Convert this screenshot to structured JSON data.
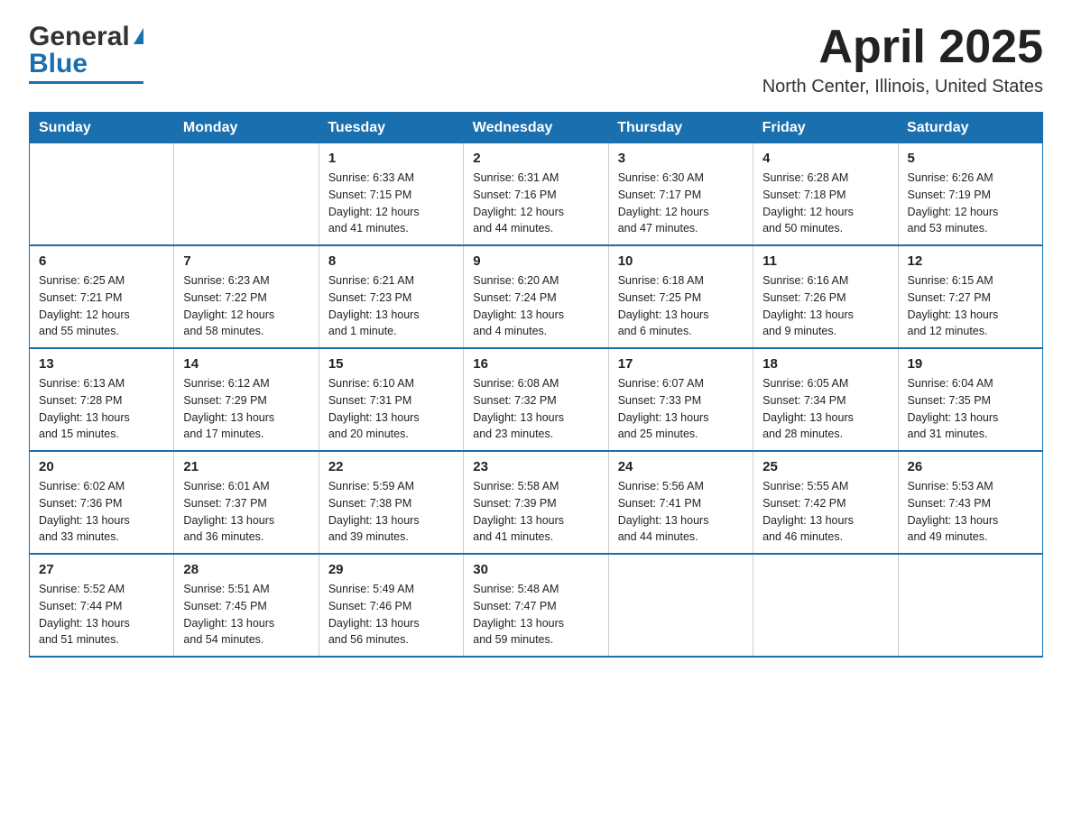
{
  "logo": {
    "text_general": "General",
    "text_blue": "Blue",
    "aria": "GeneralBlue logo"
  },
  "header": {
    "month_title": "April 2025",
    "location": "North Center, Illinois, United States"
  },
  "weekdays": [
    "Sunday",
    "Monday",
    "Tuesday",
    "Wednesday",
    "Thursday",
    "Friday",
    "Saturday"
  ],
  "weeks": [
    [
      {
        "day": "",
        "info": ""
      },
      {
        "day": "",
        "info": ""
      },
      {
        "day": "1",
        "info": "Sunrise: 6:33 AM\nSunset: 7:15 PM\nDaylight: 12 hours\nand 41 minutes."
      },
      {
        "day": "2",
        "info": "Sunrise: 6:31 AM\nSunset: 7:16 PM\nDaylight: 12 hours\nand 44 minutes."
      },
      {
        "day": "3",
        "info": "Sunrise: 6:30 AM\nSunset: 7:17 PM\nDaylight: 12 hours\nand 47 minutes."
      },
      {
        "day": "4",
        "info": "Sunrise: 6:28 AM\nSunset: 7:18 PM\nDaylight: 12 hours\nand 50 minutes."
      },
      {
        "day": "5",
        "info": "Sunrise: 6:26 AM\nSunset: 7:19 PM\nDaylight: 12 hours\nand 53 minutes."
      }
    ],
    [
      {
        "day": "6",
        "info": "Sunrise: 6:25 AM\nSunset: 7:21 PM\nDaylight: 12 hours\nand 55 minutes."
      },
      {
        "day": "7",
        "info": "Sunrise: 6:23 AM\nSunset: 7:22 PM\nDaylight: 12 hours\nand 58 minutes."
      },
      {
        "day": "8",
        "info": "Sunrise: 6:21 AM\nSunset: 7:23 PM\nDaylight: 13 hours\nand 1 minute."
      },
      {
        "day": "9",
        "info": "Sunrise: 6:20 AM\nSunset: 7:24 PM\nDaylight: 13 hours\nand 4 minutes."
      },
      {
        "day": "10",
        "info": "Sunrise: 6:18 AM\nSunset: 7:25 PM\nDaylight: 13 hours\nand 6 minutes."
      },
      {
        "day": "11",
        "info": "Sunrise: 6:16 AM\nSunset: 7:26 PM\nDaylight: 13 hours\nand 9 minutes."
      },
      {
        "day": "12",
        "info": "Sunrise: 6:15 AM\nSunset: 7:27 PM\nDaylight: 13 hours\nand 12 minutes."
      }
    ],
    [
      {
        "day": "13",
        "info": "Sunrise: 6:13 AM\nSunset: 7:28 PM\nDaylight: 13 hours\nand 15 minutes."
      },
      {
        "day": "14",
        "info": "Sunrise: 6:12 AM\nSunset: 7:29 PM\nDaylight: 13 hours\nand 17 minutes."
      },
      {
        "day": "15",
        "info": "Sunrise: 6:10 AM\nSunset: 7:31 PM\nDaylight: 13 hours\nand 20 minutes."
      },
      {
        "day": "16",
        "info": "Sunrise: 6:08 AM\nSunset: 7:32 PM\nDaylight: 13 hours\nand 23 minutes."
      },
      {
        "day": "17",
        "info": "Sunrise: 6:07 AM\nSunset: 7:33 PM\nDaylight: 13 hours\nand 25 minutes."
      },
      {
        "day": "18",
        "info": "Sunrise: 6:05 AM\nSunset: 7:34 PM\nDaylight: 13 hours\nand 28 minutes."
      },
      {
        "day": "19",
        "info": "Sunrise: 6:04 AM\nSunset: 7:35 PM\nDaylight: 13 hours\nand 31 minutes."
      }
    ],
    [
      {
        "day": "20",
        "info": "Sunrise: 6:02 AM\nSunset: 7:36 PM\nDaylight: 13 hours\nand 33 minutes."
      },
      {
        "day": "21",
        "info": "Sunrise: 6:01 AM\nSunset: 7:37 PM\nDaylight: 13 hours\nand 36 minutes."
      },
      {
        "day": "22",
        "info": "Sunrise: 5:59 AM\nSunset: 7:38 PM\nDaylight: 13 hours\nand 39 minutes."
      },
      {
        "day": "23",
        "info": "Sunrise: 5:58 AM\nSunset: 7:39 PM\nDaylight: 13 hours\nand 41 minutes."
      },
      {
        "day": "24",
        "info": "Sunrise: 5:56 AM\nSunset: 7:41 PM\nDaylight: 13 hours\nand 44 minutes."
      },
      {
        "day": "25",
        "info": "Sunrise: 5:55 AM\nSunset: 7:42 PM\nDaylight: 13 hours\nand 46 minutes."
      },
      {
        "day": "26",
        "info": "Sunrise: 5:53 AM\nSunset: 7:43 PM\nDaylight: 13 hours\nand 49 minutes."
      }
    ],
    [
      {
        "day": "27",
        "info": "Sunrise: 5:52 AM\nSunset: 7:44 PM\nDaylight: 13 hours\nand 51 minutes."
      },
      {
        "day": "28",
        "info": "Sunrise: 5:51 AM\nSunset: 7:45 PM\nDaylight: 13 hours\nand 54 minutes."
      },
      {
        "day": "29",
        "info": "Sunrise: 5:49 AM\nSunset: 7:46 PM\nDaylight: 13 hours\nand 56 minutes."
      },
      {
        "day": "30",
        "info": "Sunrise: 5:48 AM\nSunset: 7:47 PM\nDaylight: 13 hours\nand 59 minutes."
      },
      {
        "day": "",
        "info": ""
      },
      {
        "day": "",
        "info": ""
      },
      {
        "day": "",
        "info": ""
      }
    ]
  ]
}
